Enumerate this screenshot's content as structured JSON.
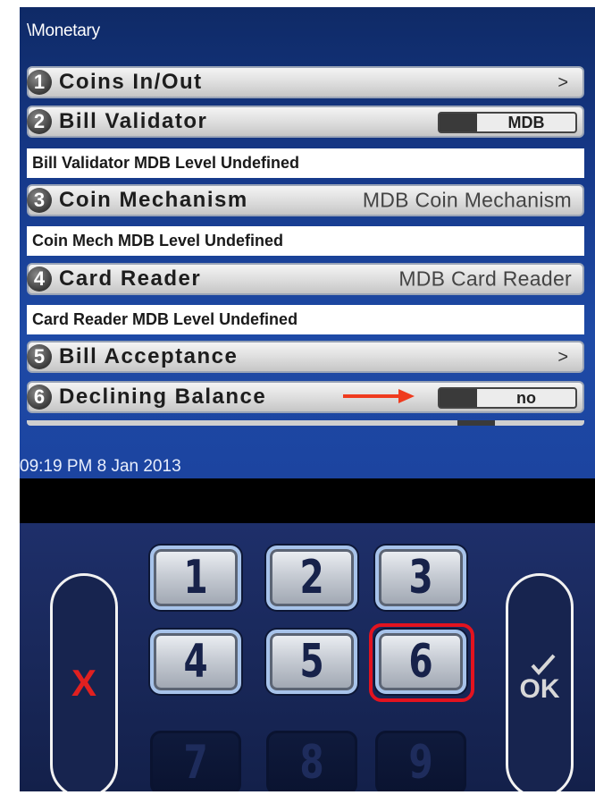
{
  "screen": {
    "path": "\\Monetary",
    "rows": [
      {
        "number": "1",
        "label": "Coins In/Out",
        "chevron": ">"
      },
      {
        "number": "2",
        "label": "Bill Validator",
        "toggle": "MDB"
      },
      {
        "number": "3",
        "label": "Coin Mechanism",
        "value": "MDB Coin Mechanism"
      },
      {
        "number": "4",
        "label": "Card Reader",
        "value": "MDB Card Reader"
      },
      {
        "number": "5",
        "label": "Bill Acceptance",
        "chevron": ">"
      },
      {
        "number": "6",
        "label": "Declining Balance",
        "toggle": "no"
      }
    ],
    "info": [
      "Bill Validator MDB Level Undefined",
      "Coin Mech MDB Level Undefined",
      "Card Reader MDB Level Undefined"
    ],
    "datetime": "09:19 PM 8 Jan 2013"
  },
  "keypad": {
    "cancel": "X",
    "ok": "OK",
    "keys": [
      "1",
      "2",
      "3",
      "4",
      "5",
      "6",
      "7",
      "8",
      "9"
    ]
  },
  "colors": {
    "screen_blue": "#1c44a0",
    "keypad_navy": "#19285a",
    "highlight_red": "#e3131f",
    "arrow_orange": "#ef3b1e",
    "cancel_red": "#e02020"
  }
}
